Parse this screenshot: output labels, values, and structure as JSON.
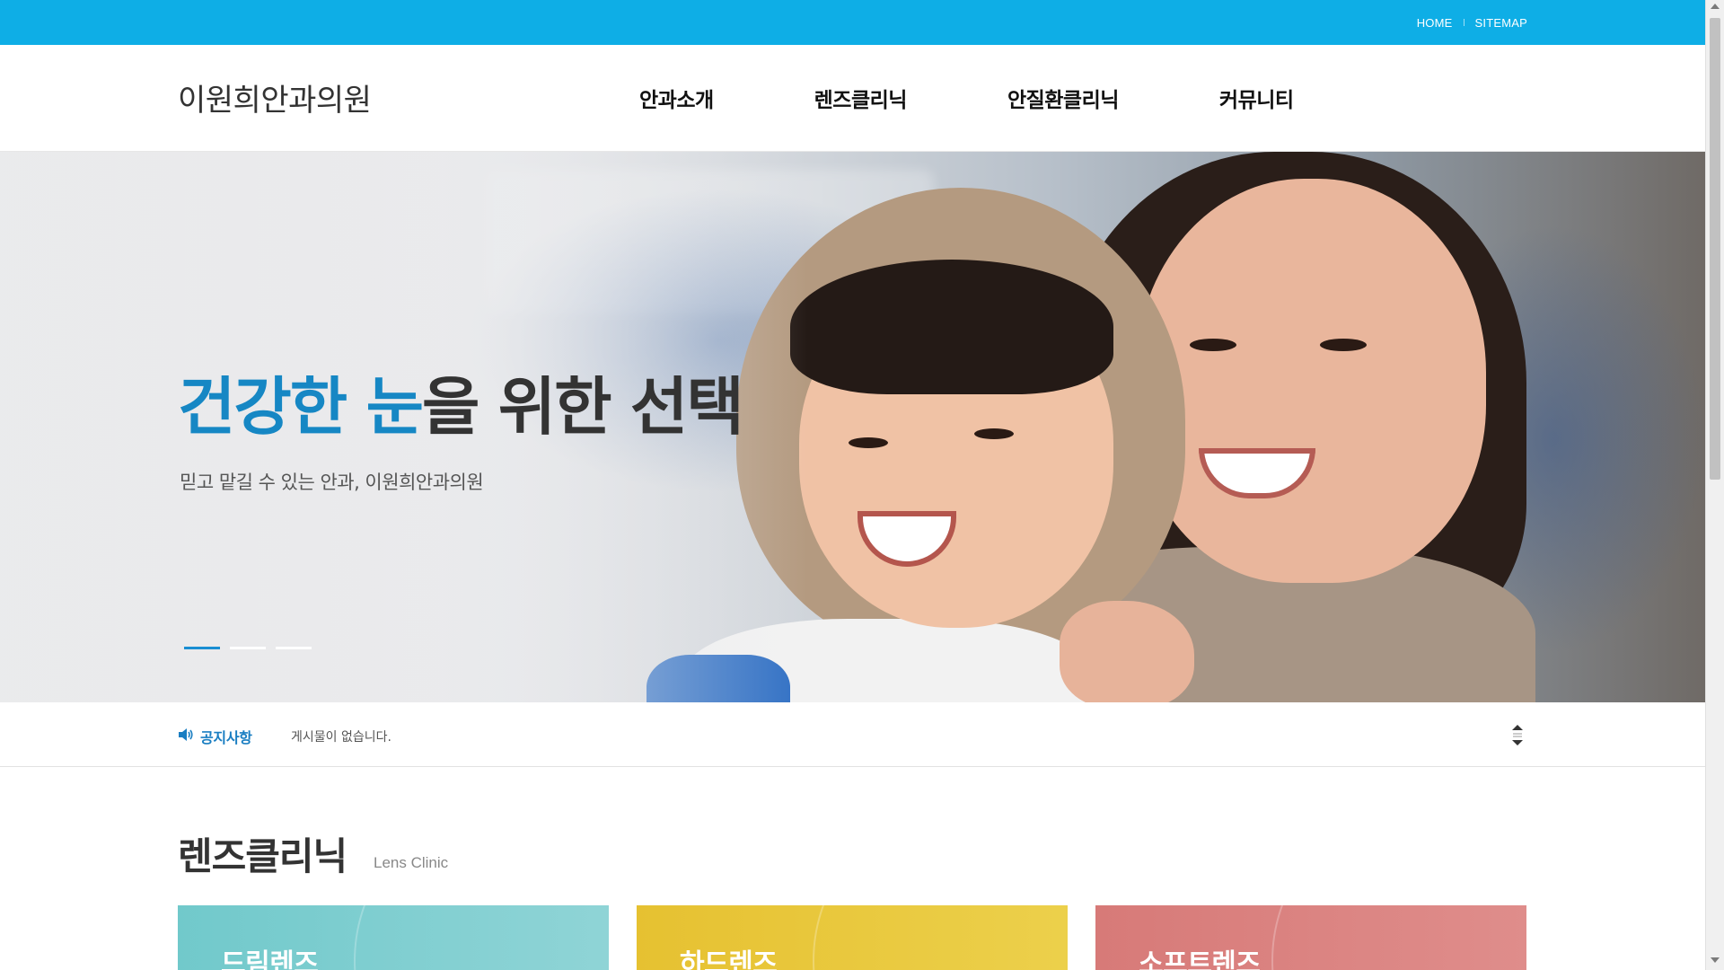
{
  "utility": {
    "home": "HOME",
    "sitemap": "SITEMAP"
  },
  "header": {
    "logo": "이원희안과의원",
    "nav": [
      "안과소개",
      "렌즈클리닉",
      "안질환클리닉",
      "커뮤니티"
    ]
  },
  "hero": {
    "title_accent": "건강한 눈",
    "title_rest": "을 위한 선택",
    "subtitle": "믿고 맡길 수 있는 안과, 이원희안과의원",
    "slides_count": 3,
    "active_slide": 1
  },
  "notice": {
    "label": "공지사항",
    "text": "게시물이 없습니다."
  },
  "section": {
    "title": "렌즈클리닉",
    "subtitle": "Lens Clinic",
    "cards": [
      "드림렌즈",
      "하드렌즈",
      "소프트렌즈"
    ]
  },
  "colors": {
    "topbar": "#0eaee6",
    "accent": "#1687c4",
    "card_teal": "#71c9cb",
    "card_yellow": "#e6c131",
    "card_red": "#d77a78"
  }
}
